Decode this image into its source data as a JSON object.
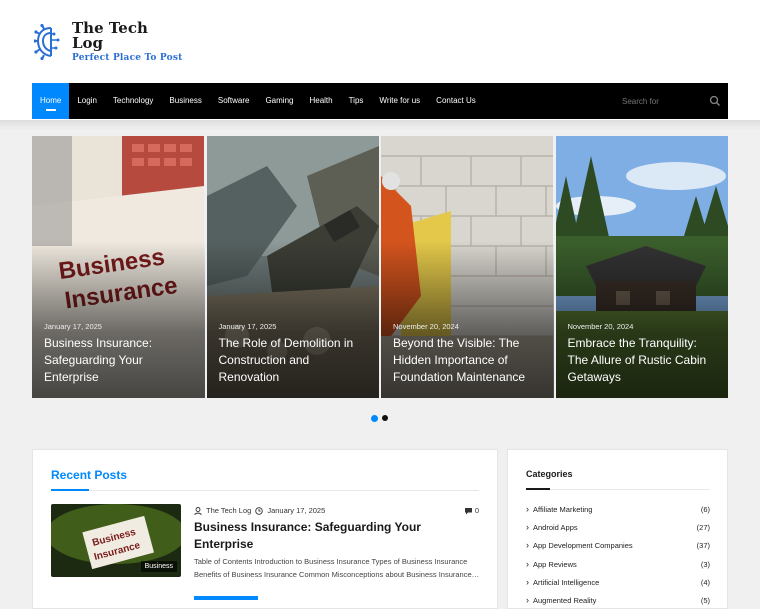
{
  "site": {
    "title_prefix": "The ",
    "title_main": "Tech Log",
    "tagline": "Perfect Place To Post"
  },
  "nav": {
    "items": [
      "Home",
      "Login",
      "Technology",
      "Business",
      "Software",
      "Gaming",
      "Health",
      "Tips",
      "Write for us",
      "Contact Us"
    ],
    "active": "Home",
    "search_placeholder": "Search for"
  },
  "slider": {
    "slides": [
      {
        "date": "January 17, 2025",
        "title": "Business Insurance: Safeguarding Your Enterprise"
      },
      {
        "date": "January 17, 2025",
        "title": "The Role of Demolition in Construction and Renovation"
      },
      {
        "date": "November 20, 2024",
        "title": "Beyond the Visible: The Hidden Importance of Foundation Maintenance"
      },
      {
        "date": "November 20, 2024",
        "title": "Embrace the Tranquility: The Allure of Rustic Cabin Getaways"
      }
    ],
    "page_count": 2,
    "current_page": 1
  },
  "recent": {
    "heading": "Recent Posts",
    "post": {
      "author": "The Tech Log",
      "date": "January 17, 2025",
      "comments": "0",
      "category": "Business",
      "title": "Business Insurance: Safeguarding Your Enterprise",
      "excerpt": "Table of Contents Introduction to Business Insurance Types of Business Insurance Benefits of Business Insurance Common Misconceptions about Business Insurance…"
    }
  },
  "categories": {
    "heading": "Categories",
    "items": [
      {
        "name": "Affiliate Marketing",
        "count": "(6)"
      },
      {
        "name": "Android Apps",
        "count": "(27)"
      },
      {
        "name": "App Development Companies",
        "count": "(37)"
      },
      {
        "name": "App Reviews",
        "count": "(3)"
      },
      {
        "name": "Artificial Intelligence",
        "count": "(4)"
      },
      {
        "name": "Augmented Reality",
        "count": "(5)"
      }
    ]
  },
  "colors": {
    "accent": "#0088ff",
    "nav_bg": "#000000",
    "logo_blue": "#2a6fd6"
  }
}
